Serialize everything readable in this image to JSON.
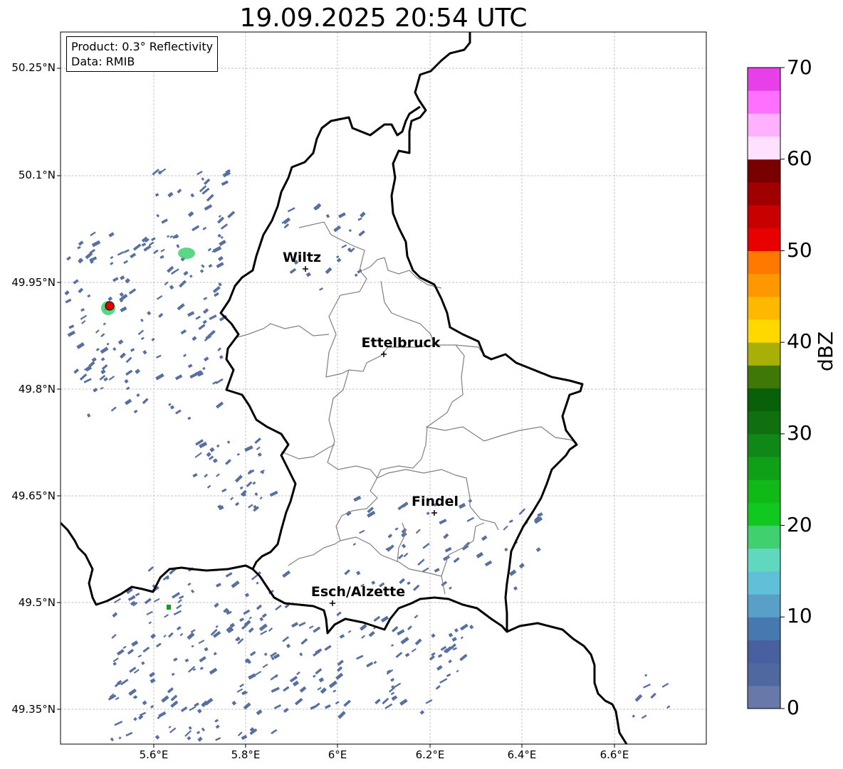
{
  "title": "19.09.2025 20:54 UTC",
  "info_box": {
    "product": "Product: 0.3° Reflectivity",
    "data": "Data: RMIB"
  },
  "lat_labels": [
    "50.25°N",
    "50.1°N",
    "49.95°N",
    "49.8°N",
    "49.65°N",
    "49.5°N",
    "49.35°N"
  ],
  "lon_labels": [
    "5.6°E",
    "5.8°E",
    "6°E",
    "6.2°E",
    "6.4°E",
    "6.6°E"
  ],
  "cities": [
    {
      "name": "Wiltz"
    },
    {
      "name": "Ettelbruck"
    },
    {
      "name": "Findel"
    },
    {
      "name": "Esch/Alzette"
    }
  ],
  "colorbar": {
    "label": "dBZ",
    "ticks": [
      "0",
      "10",
      "20",
      "30",
      "40",
      "50",
      "60",
      "70"
    ],
    "colors": [
      "#6878a8",
      "#5068a0",
      "#4860a0",
      "#4878b0",
      "#58a0c8",
      "#60c0d8",
      "#60d8c0",
      "#40d070",
      "#10c820",
      "#10b818",
      "#10a018",
      "#108818",
      "#107010",
      "#086008",
      "#407808",
      "#a8b008",
      "#ffd800",
      "#ffb800",
      "#ff9800",
      "#ff7800",
      "#e80000",
      "#c80000",
      "#a00000",
      "#780000",
      "#ffe0ff",
      "#ffb0ff",
      "#ff70ff",
      "#e840e8"
    ]
  },
  "colors": {
    "radar_echo": "#5870a0",
    "border": "#000000",
    "canton": "#808080",
    "grid": "#b0b0b0",
    "radar_site": "#e00000"
  }
}
